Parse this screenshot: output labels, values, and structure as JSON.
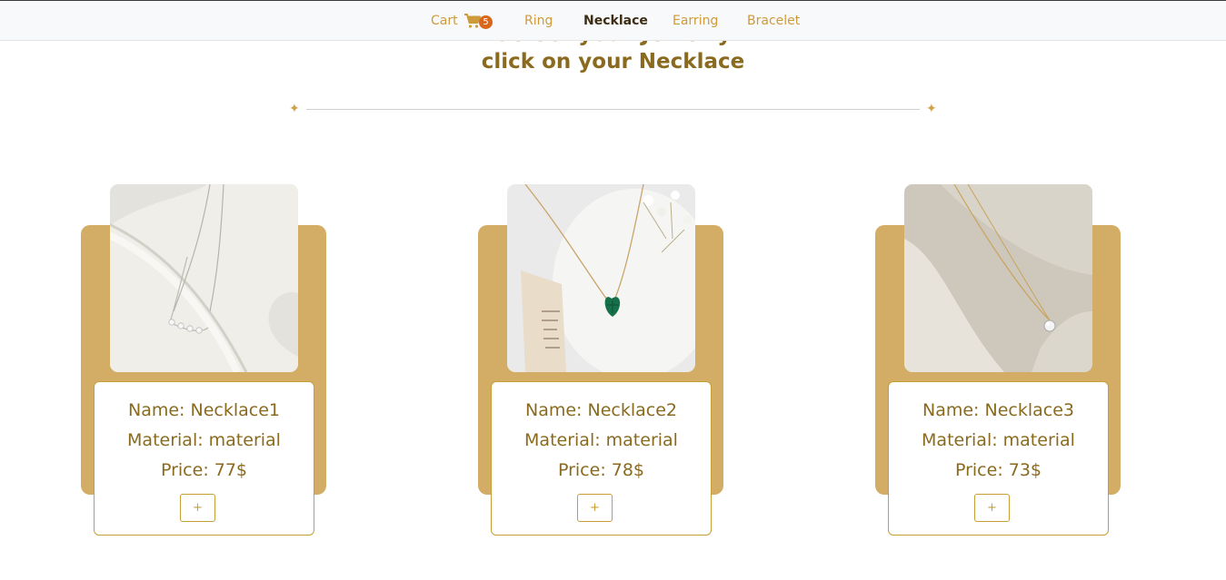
{
  "navbar": {
    "cart_label": "Cart",
    "cart_icon": "shopping-cart-icon",
    "cart_count": "5",
    "links": [
      "Ring",
      "Necklace",
      "Earring",
      "Bracelet"
    ],
    "active": "Necklace"
  },
  "header": {
    "heading_cut": "Select your Jewelry",
    "heading": "click on your Necklace",
    "divider_star": "✦"
  },
  "products": [
    {
      "name": "Name: Necklace1",
      "material": "Material: material",
      "price": "Price: 77$",
      "add_label": "+"
    },
    {
      "name": "Name: Necklace2",
      "material": "Material: material",
      "price": "Price: 78$",
      "add_label": "+"
    },
    {
      "name": "Name: Necklace3",
      "material": "Material: material",
      "price": "Price: 73$",
      "add_label": "+"
    }
  ],
  "colors": {
    "accent": "#cf9a3a",
    "card_background": "#d3ad66",
    "text_brown": "#8a6a1f",
    "badge": "#d8661b"
  }
}
